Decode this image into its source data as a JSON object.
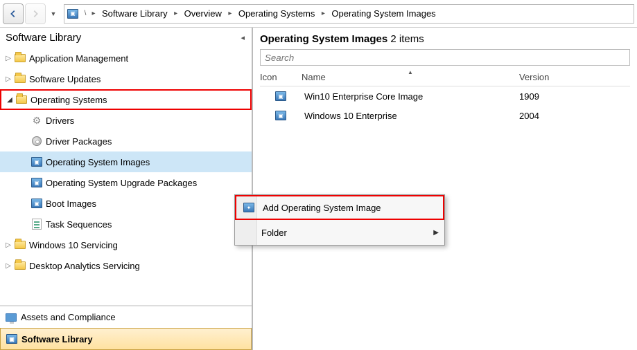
{
  "breadcrumb": {
    "segments": [
      "Software Library",
      "Overview",
      "Operating Systems",
      "Operating System Images"
    ]
  },
  "sidebar": {
    "title": "Software Library",
    "items": [
      {
        "label": "Application Management",
        "depth": 0,
        "expander": "closed",
        "icon": "folder"
      },
      {
        "label": "Software Updates",
        "depth": 0,
        "expander": "closed",
        "icon": "folder"
      },
      {
        "label": "Operating Systems",
        "depth": 0,
        "expander": "open",
        "icon": "folder",
        "highlight": true
      },
      {
        "label": "Drivers",
        "depth": 1,
        "expander": "none",
        "icon": "gear"
      },
      {
        "label": "Driver Packages",
        "depth": 1,
        "expander": "none",
        "icon": "disc"
      },
      {
        "label": "Operating System Images",
        "depth": 1,
        "expander": "none",
        "icon": "osimage",
        "selected": true
      },
      {
        "label": "Operating System Upgrade Packages",
        "depth": 1,
        "expander": "none",
        "icon": "osimage"
      },
      {
        "label": "Boot Images",
        "depth": 1,
        "expander": "none",
        "icon": "osimage"
      },
      {
        "label": "Task Sequences",
        "depth": 1,
        "expander": "none",
        "icon": "sequence"
      },
      {
        "label": "Windows 10 Servicing",
        "depth": 0,
        "expander": "closed",
        "icon": "folder"
      },
      {
        "label": "Desktop Analytics Servicing",
        "depth": 0,
        "expander": "closed",
        "icon": "folder"
      }
    ],
    "workspaces": [
      {
        "label": "Assets and Compliance",
        "active": false
      },
      {
        "label": "Software Library",
        "active": true
      }
    ]
  },
  "content": {
    "header_prefix": "Operating System Images",
    "header_suffix": " 2 items",
    "search_placeholder": "Search",
    "columns": {
      "icon": "Icon",
      "name": "Name",
      "version": "Version"
    },
    "rows": [
      {
        "name": "Win10 Enterprise Core Image",
        "version": "1909"
      },
      {
        "name": "Windows 10 Enterprise",
        "version": "2004"
      }
    ]
  },
  "context_menu": {
    "add_label": "Add Operating System Image",
    "folder_label": "Folder"
  }
}
